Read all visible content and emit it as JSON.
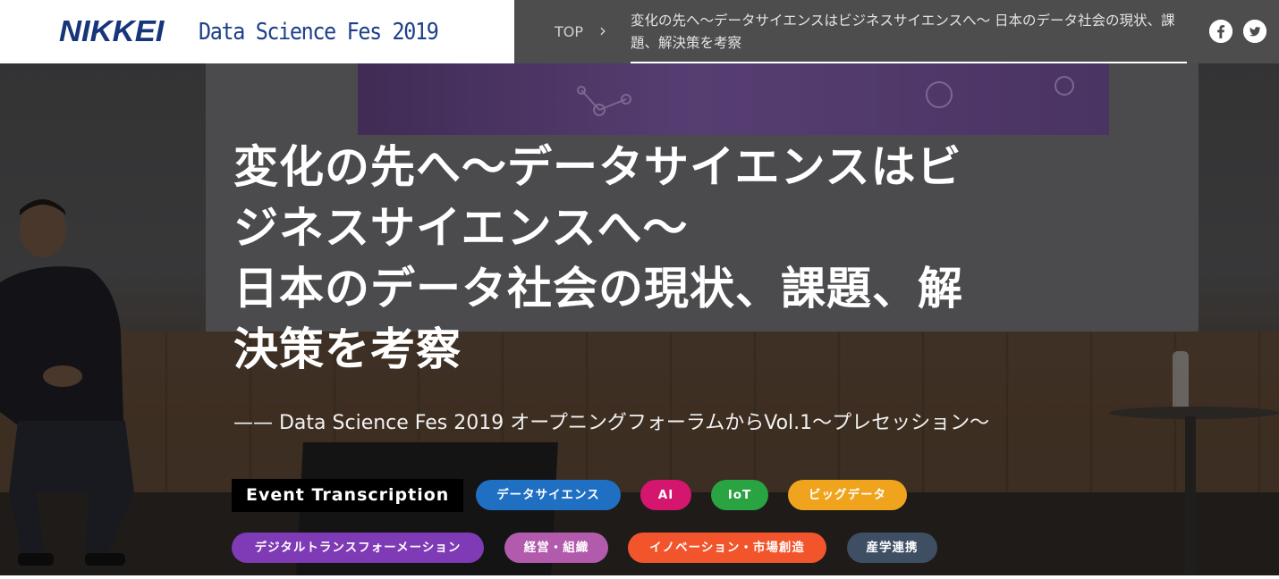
{
  "header": {
    "logo": "NIKKEI",
    "site_name": "Data Science Fes 2019",
    "nav_top": "TOP",
    "breadcrumb_current": "変化の先へ〜データサイエンスはビジネスサイエンスへ〜 日本のデータ社会の現状、課題、解決策を考察",
    "social": [
      {
        "icon": "facebook-icon"
      },
      {
        "icon": "twitter-icon"
      }
    ]
  },
  "hero": {
    "title_line1": "変化の先へ〜データサイエンスはビ",
    "title_line2": "ジネスサイエンスへ〜",
    "title_line3": "日本のデータ社会の現状、課題、解",
    "title_line4": "決策を考察",
    "subtitle": "—— Data Science Fes 2019 オープニングフォーラムからVol.1〜プレセッション〜",
    "category": "Event Transcription",
    "tags": [
      {
        "label": "データサイエンス",
        "color": "#1f6fc3"
      },
      {
        "label": "AI",
        "color": "#d4166f"
      },
      {
        "label": "IoT",
        "color": "#2aa443"
      },
      {
        "label": "ビッグデータ",
        "color": "#f0a41e"
      },
      {
        "label": "デジタルトランスフォーメーション",
        "color": "#7f3ab5"
      },
      {
        "label": "経営・組織",
        "color": "#b25aac"
      },
      {
        "label": "イノベーション・市場創造",
        "color": "#f2552c"
      },
      {
        "label": "産学連携",
        "color": "#3e4f63"
      }
    ]
  }
}
